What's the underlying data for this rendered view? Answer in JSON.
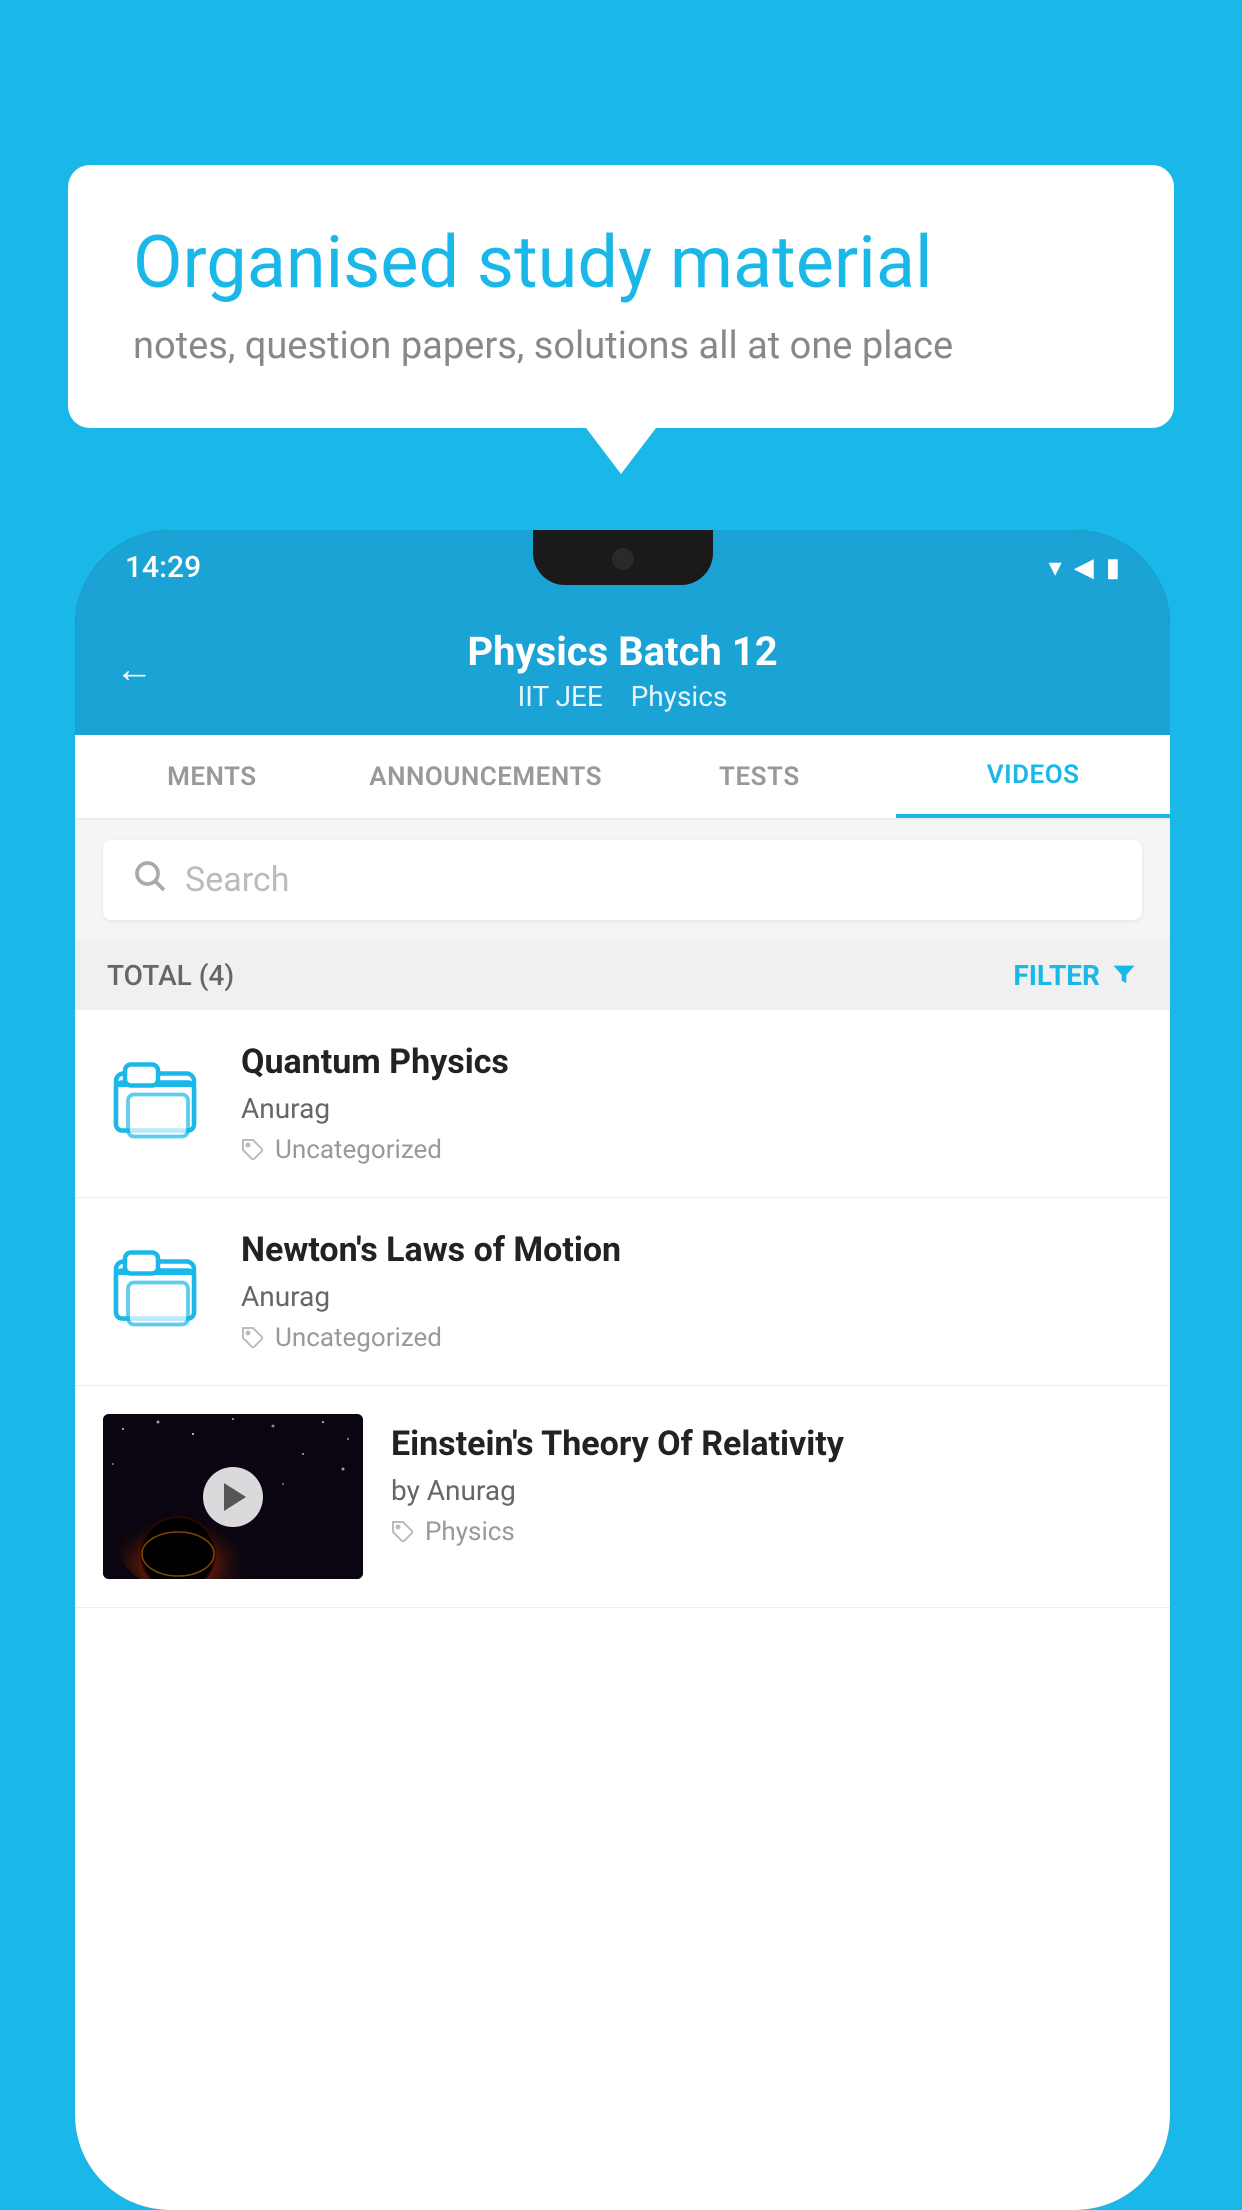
{
  "background_color": "#1ab8e8",
  "speech_bubble": {
    "title": "Organised study material",
    "subtitle": "notes, question papers, solutions all at one place"
  },
  "phone": {
    "status_bar": {
      "time": "14:29"
    },
    "header": {
      "back_label": "←",
      "title": "Physics Batch 12",
      "subtitle_tags": [
        "IIT JEE",
        "Physics"
      ]
    },
    "tabs": [
      {
        "label": "MENTS",
        "active": false
      },
      {
        "label": "ANNOUNCEMENTS",
        "active": false
      },
      {
        "label": "TESTS",
        "active": false
      },
      {
        "label": "VIDEOS",
        "active": true
      }
    ],
    "search": {
      "placeholder": "Search"
    },
    "filter_bar": {
      "total_label": "TOTAL (4)",
      "filter_label": "FILTER"
    },
    "videos": [
      {
        "id": 1,
        "title": "Quantum Physics",
        "author": "Anurag",
        "tag": "Uncategorized",
        "has_thumbnail": false
      },
      {
        "id": 2,
        "title": "Newton's Laws of Motion",
        "author": "Anurag",
        "tag": "Uncategorized",
        "has_thumbnail": false
      },
      {
        "id": 3,
        "title": "Einstein's Theory Of Relativity",
        "author": "by Anurag",
        "tag": "Physics",
        "has_thumbnail": true
      }
    ]
  }
}
